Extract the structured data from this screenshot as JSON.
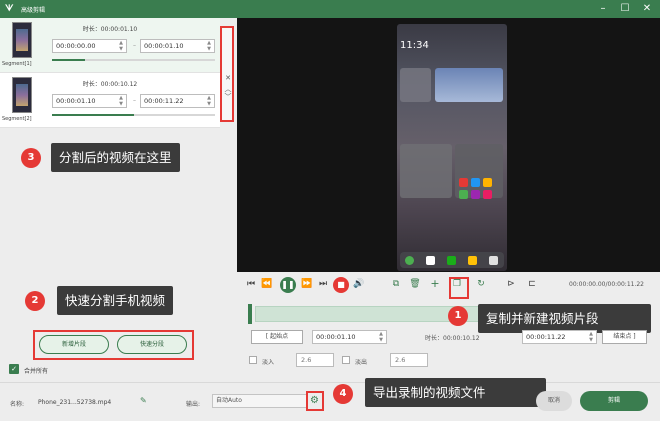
{
  "app": {
    "title": "高级剪辑",
    "logo_icon": "app-logo-icon"
  },
  "window": {
    "minimize_icon": "minimize-icon",
    "maximize_icon": "maximize-icon",
    "close_icon": "close-icon"
  },
  "segments": [
    {
      "label": "Segment[1]",
      "duration_label": "时长：",
      "duration": "00:00:01.10",
      "start": "00:00:00.00",
      "end": "00:00:01.10",
      "progress": 0.2
    },
    {
      "label": "Segment[2]",
      "duration_label": "时长：",
      "duration": "00:00:10.12",
      "start": "00:00:01.10",
      "end": "00:00:11.22",
      "progress": 0.5
    }
  ],
  "segment_tools": {
    "delete_icon": "close-icon",
    "up_icon": "chevron-up-icon",
    "down_icon": "chevron-down-icon"
  },
  "callouts": [
    {
      "num": "3",
      "text": "分割后的视频在这里"
    },
    {
      "num": "2",
      "text": "快速分割手机视频"
    },
    {
      "num": "1",
      "text": "复制并新建视频片段"
    },
    {
      "num": "4",
      "text": "导出录制的视频文件"
    }
  ],
  "buttons": {
    "new_segment": "新增片段",
    "quick_split": "快速分段",
    "export": "剪辑",
    "cancel": "取消"
  },
  "merge": {
    "label": "合并所有",
    "checked": true
  },
  "preview": {
    "clock": "11:34"
  },
  "player": {
    "time_display": "00:00:00.00/00:00:11.22",
    "prev_icon": "skip-previous-icon",
    "rewind_icon": "rewind-icon",
    "play_icon": "pause-icon",
    "forward_icon": "forward-icon",
    "next_icon": "skip-next-icon",
    "stop_icon": "stop-icon",
    "volume_icon": "volume-icon",
    "split_icon": "split-icon",
    "delete_icon": "trash-icon",
    "add_icon": "plus-icon",
    "copy_icon": "copy-segment-icon",
    "reset_icon": "reset-icon",
    "frame_prev_icon": "frame-prev-icon",
    "frame_next_icon": "frame-next-icon"
  },
  "range": {
    "set_start": "起始点",
    "start": "00:00:01.10",
    "duration_label": "时长：",
    "duration": "00:00:10.12",
    "end": "00:00:11.22",
    "set_end": "结束点"
  },
  "fade": {
    "in_label": "淡入",
    "in_value": "2.6",
    "out_label": "淡出",
    "out_value": "2.6"
  },
  "file": {
    "name_label": "名称:",
    "name_value": "Phone_231...52738.mp4",
    "output_label": "输出:",
    "output_value": "自动Auto"
  },
  "colors": {
    "accent": "#3a7d4f",
    "highlight": "#e53935"
  }
}
